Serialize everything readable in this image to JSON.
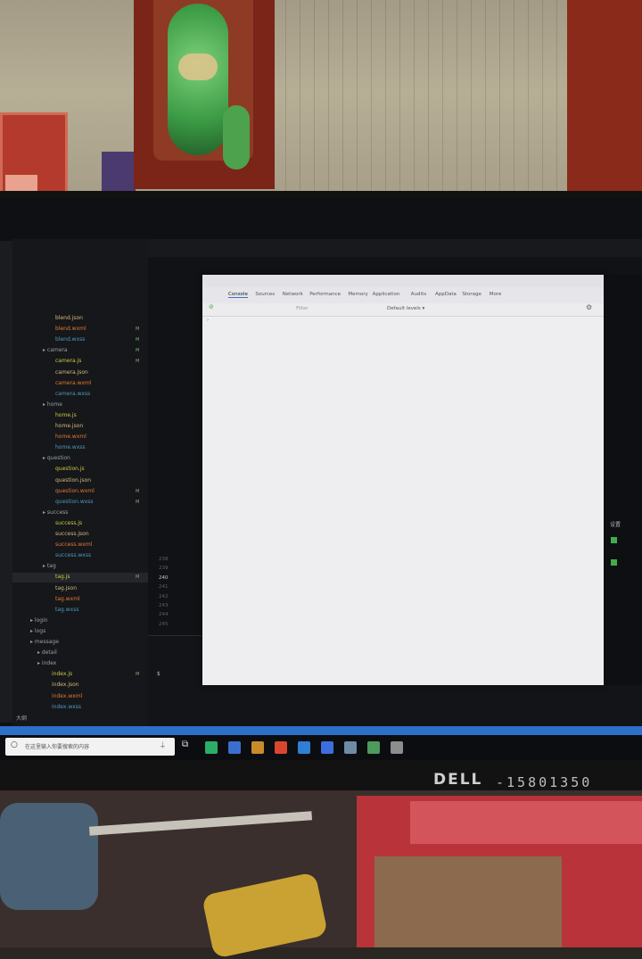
{
  "explorer": {
    "items": [
      {
        "label": "blend.json",
        "kind": "json"
      },
      {
        "label": "blend.wxml",
        "kind": "wxml",
        "mark": "M"
      },
      {
        "label": "blend.wxss",
        "kind": "wxss",
        "mark": "M"
      },
      {
        "label": "camera",
        "kind": "folder",
        "mark": "M"
      },
      {
        "label": "camera.js",
        "kind": "js",
        "mark": "M"
      },
      {
        "label": "camera.json",
        "kind": "json"
      },
      {
        "label": "camera.wxml",
        "kind": "wxml"
      },
      {
        "label": "camera.wxss",
        "kind": "wxss"
      },
      {
        "label": "home",
        "kind": "folder"
      },
      {
        "label": "home.js",
        "kind": "js"
      },
      {
        "label": "home.json",
        "kind": "json"
      },
      {
        "label": "home.wxml",
        "kind": "wxml"
      },
      {
        "label": "home.wxss",
        "kind": "wxss"
      },
      {
        "label": "question",
        "kind": "folder"
      },
      {
        "label": "question.js",
        "kind": "js"
      },
      {
        "label": "question.json",
        "kind": "json"
      },
      {
        "label": "question.wxml",
        "kind": "wxml",
        "mark": "M"
      },
      {
        "label": "question.wxss",
        "kind": "wxss",
        "mark": "M"
      },
      {
        "label": "success",
        "kind": "folder"
      },
      {
        "label": "success.js",
        "kind": "js"
      },
      {
        "label": "success.json",
        "kind": "json"
      },
      {
        "label": "success.wxml",
        "kind": "wxml"
      },
      {
        "label": "success.wxss",
        "kind": "wxss"
      },
      {
        "label": "tag",
        "kind": "folder"
      },
      {
        "label": "tag.js",
        "kind": "js",
        "mark": "M"
      },
      {
        "label": "tag.json",
        "kind": "json"
      },
      {
        "label": "tag.wxml",
        "kind": "wxml"
      },
      {
        "label": "tag.wxss",
        "kind": "wxss"
      },
      {
        "label": "login",
        "kind": "folder"
      },
      {
        "label": "logs",
        "kind": "folder"
      },
      {
        "label": "message",
        "kind": "folder"
      },
      {
        "label": "detail",
        "kind": "folder"
      },
      {
        "label": "index",
        "kind": "folder"
      },
      {
        "label": "index.js",
        "kind": "js",
        "mark": "M"
      },
      {
        "label": "index.json",
        "kind": "json"
      },
      {
        "label": "index.wxml",
        "kind": "wxml"
      },
      {
        "label": "index.wxss",
        "kind": "wxss"
      }
    ],
    "outline_label": "大纲"
  },
  "editor": {
    "line_numbers": [
      "238",
      "239",
      "240",
      "241",
      "242",
      "243",
      "244",
      "245"
    ],
    "terminal_prompt": "$"
  },
  "devtools": {
    "tabs": [
      "Console",
      "Sources",
      "Network",
      "Performance",
      "Memory",
      "Application",
      "Audits",
      "AppData",
      "Storage",
      "More"
    ],
    "filter_placeholder": "Filter",
    "levels_label": "Default levels ▾",
    "console_prompt": "›"
  },
  "side_panel": {
    "settings_label": "设置",
    "checkbox_colors": [
      "#3fae49",
      "#3fae49"
    ]
  },
  "taskbar": {
    "search_placeholder": "在这里输入你要搜索的内容",
    "app_icons": [
      {
        "name": "wechat-icon",
        "color": "#2aae67"
      },
      {
        "name": "search-app-icon",
        "color": "#3a6fd0"
      },
      {
        "name": "tool-icon",
        "color": "#c98b2a"
      },
      {
        "name": "chrome-icon",
        "color": "#d9462f"
      },
      {
        "name": "vscode-icon",
        "color": "#2f7fd4"
      },
      {
        "name": "app-blue-icon",
        "color": "#3d6ee0"
      },
      {
        "name": "folder-icon",
        "color": "#6f8aa3"
      },
      {
        "name": "app-green-icon",
        "color": "#4d9a5d"
      },
      {
        "name": "app-grey-icon",
        "color": "#8d8d8d"
      }
    ]
  },
  "monitor": {
    "brand": "DELL",
    "sticker": "-15801350"
  },
  "colors": {
    "status_bar": "#2e6fc7",
    "devtools_bg": "#eeeef0"
  }
}
